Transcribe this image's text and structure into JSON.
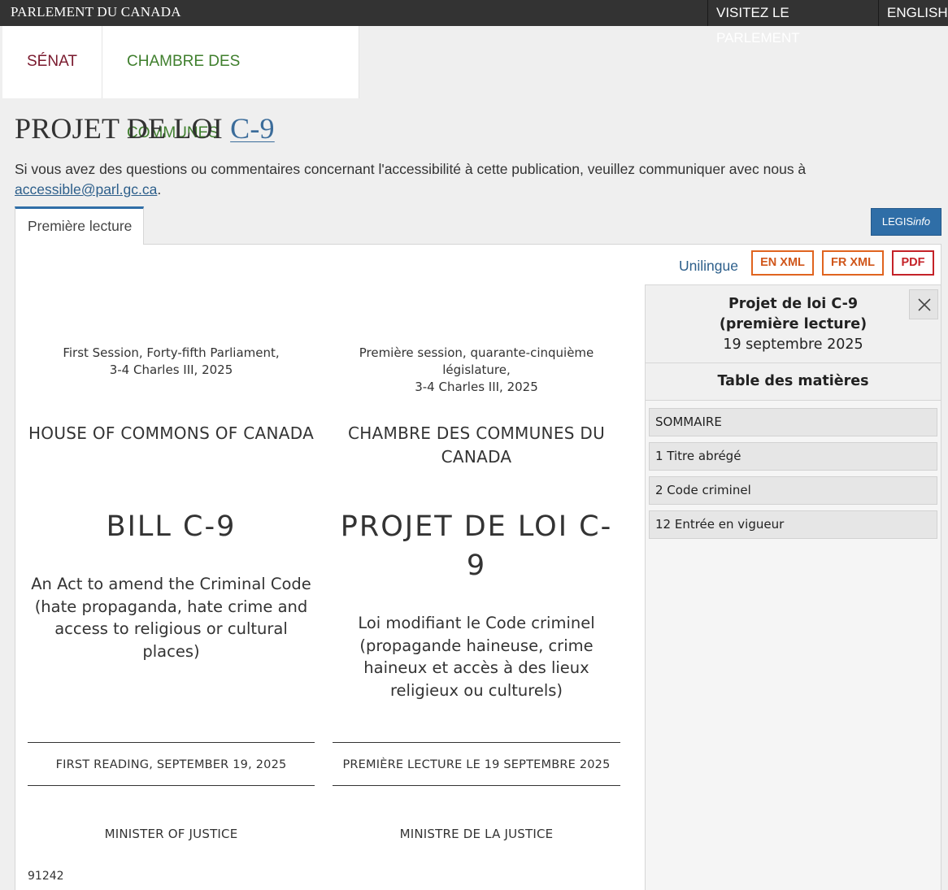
{
  "topbar": {
    "brand": "PARLEMENT DU CANADA",
    "visit": "VISITEZ LE PARLEMENT",
    "language": "ENGLISH"
  },
  "chambers": {
    "senate": "SÉNAT",
    "commons": "CHAMBRE DES COMMUNES"
  },
  "title": {
    "prefix": "PROJET DE LOI",
    "bill_link": "C-9"
  },
  "accessibility": {
    "text": "Si vous avez des questions ou commentaires concernant l'accessibilité à cette publication, veuillez communiquer avec nous à",
    "email": "accessible@parl.gc.ca",
    "suffix": "."
  },
  "tabs": {
    "active": "Première lecture",
    "legis_prefix": "LEGIS",
    "legis_suffix": "info"
  },
  "formats": {
    "unilingue": "Unilingue",
    "en_xml": "EN XML",
    "fr_xml": "FR XML",
    "pdf": "PDF"
  },
  "bill": {
    "en": {
      "session_line1": "First Session, Forty-fifth Parliament,",
      "session_line2": "3-4 Charles III, 2025",
      "house": "HOUSE OF COMMONS OF CANADA",
      "number": "BILL C-9",
      "title": "An Act to amend the Criminal Code (hate propaganda, hate crime and access to religious or cultural places)",
      "reading": "FIRST READING, SEPTEMBER 19, 2025",
      "minister": "MINISTER OF JUSTICE"
    },
    "fr": {
      "session_line1": "Première session, quarante-cinquième législature,",
      "session_line2": "3-4 Charles III, 2025",
      "house": "CHAMBRE DES COMMUNES DU CANADA",
      "number": "PROJET DE LOI C-9",
      "title": "Loi modifiant le Code criminel (propagande haineuse, crime haineux et accès à des lieux religieux ou culturels)",
      "reading": "PREMIÈRE LECTURE LE 19 SEPTEMBRE 2025",
      "minister": "MINISTRE DE LA JUSTICE"
    },
    "code": "91242"
  },
  "toc": {
    "heading_line1": "Projet de loi C-9",
    "heading_line2": "(première lecture)",
    "date": "19 septembre 2025",
    "title": "Table des matières",
    "items": [
      {
        "label": "SOMMAIRE"
      },
      {
        "label": "1 Titre abrégé"
      },
      {
        "label": "2 Code criminel"
      },
      {
        "label": "12 Entrée en vigueur"
      }
    ]
  }
}
